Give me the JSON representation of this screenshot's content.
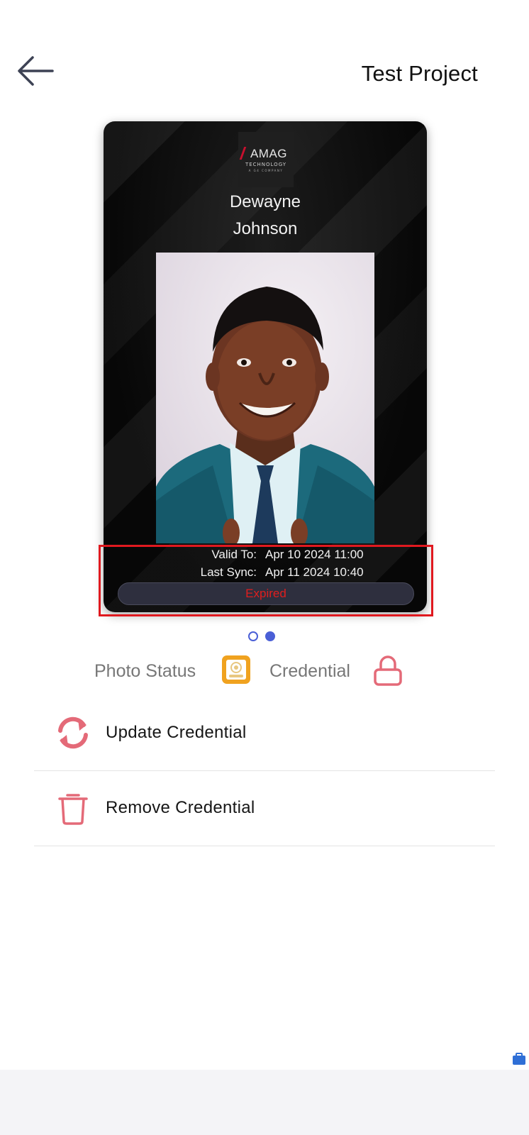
{
  "header": {
    "back_icon": "arrow-left-icon",
    "title": "Test Project"
  },
  "card": {
    "logo": {
      "brand": "AMAG",
      "subtitle": "TECHNOLOGY",
      "tagline": "A G4 COMPANY"
    },
    "name_line1": "Dewayne",
    "name_line2": "Johnson",
    "valid_to_label": "Valid To:",
    "valid_to_value": "Apr 10 2024 11:00",
    "last_sync_label": "Last Sync:",
    "last_sync_value": "Apr 11 2024 10:40",
    "status": "Expired",
    "status_color": "#e01e1e"
  },
  "pager": {
    "total": 2,
    "active_index": 1
  },
  "status_row": {
    "photo_status_label": "Photo Status",
    "photo_status_icon": "photo-approved-icon",
    "credential_label": "Credential",
    "credential_icon": "lock-icon"
  },
  "actions": [
    {
      "label": "Update Credential",
      "icon": "refresh-icon"
    },
    {
      "label": "Remove Credential",
      "icon": "trash-icon"
    }
  ],
  "colors": {
    "accent": "#4a5fd6",
    "action_icon": "#e46a78",
    "photo_status_icon": "#f0a21f",
    "highlight": "#e0191f"
  }
}
